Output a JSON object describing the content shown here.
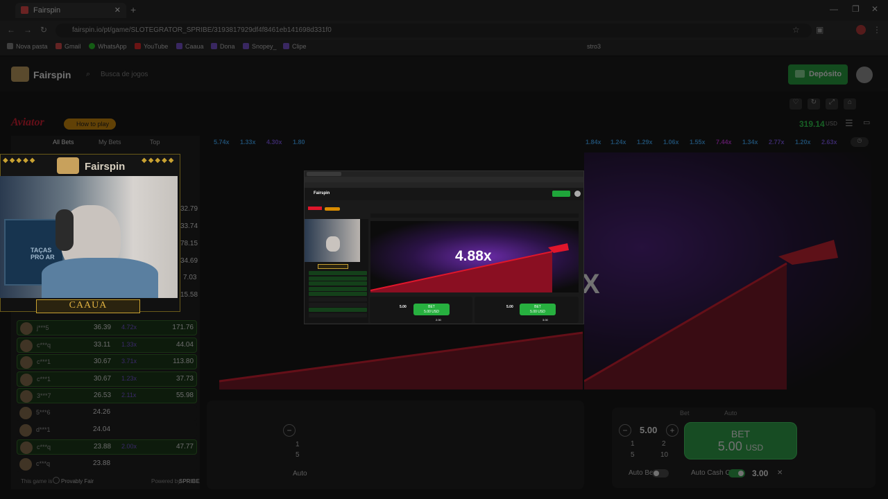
{
  "browser": {
    "tab_title": "Fairspin",
    "url": "fairspin.io/pt/game/SLOTEGRATOR_SPRIBE/3193817929df4f8461eb141698d331f0",
    "bookmarks": [
      "Nova pasta",
      "Gmail",
      "WhatsApp",
      "YouTube",
      "Caaua",
      "Dona",
      "Snopey_",
      "Clipe",
      "stro3"
    ]
  },
  "site": {
    "brand": "Fairspin",
    "search_placeholder": "Busca de jogos",
    "deposit_label": "Depósito",
    "balance": "319.14",
    "currency": "USD"
  },
  "game": {
    "title": "Aviator",
    "how_to_play": "How to play",
    "current_multiplier": "4.88x",
    "history": [
      "5.74x",
      "1.33x",
      "4.30x",
      "1.80"
    ],
    "history_right": [
      "1.84x",
      "1.24x",
      "1.29x",
      "1.06x",
      "1.55x",
      "7.44x",
      "1.34x",
      "2.77x",
      "1.20x",
      "2.63x"
    ]
  },
  "bets_panel": {
    "tabs": [
      "All Bets",
      "My Bets",
      "Top"
    ],
    "partial_values": [
      "32.79",
      "33.74",
      "78.15",
      "34.69",
      "7.03",
      "15.58"
    ],
    "rows": [
      {
        "user": "j***5",
        "bet": "36.39",
        "mult": "4.72x",
        "win": "171.76",
        "won": true
      },
      {
        "user": "c***q",
        "bet": "33.11",
        "mult": "1.33x",
        "win": "44.04",
        "won": true
      },
      {
        "user": "c***1",
        "bet": "30.67",
        "mult": "3.71x",
        "win": "113.80",
        "won": true
      },
      {
        "user": "c***1",
        "bet": "30.67",
        "mult": "1.23x",
        "win": "37.73",
        "won": true
      },
      {
        "user": "3***7",
        "bet": "26.53",
        "mult": "2.11x",
        "win": "55.98",
        "won": true
      },
      {
        "user": "5***6",
        "bet": "24.26",
        "mult": "",
        "win": "",
        "won": false
      },
      {
        "user": "d***1",
        "bet": "24.04",
        "mult": "",
        "win": "",
        "won": false
      },
      {
        "user": "c***q",
        "bet": "23.88",
        "mult": "2.00x",
        "win": "47.77",
        "won": true
      },
      {
        "user": "c***q",
        "bet": "23.88",
        "mult": "",
        "win": "",
        "won": false
      }
    ],
    "footer_fair": "This game is",
    "footer_fair_badge": "Provably Fair",
    "footer_powered": "Powered by",
    "footer_powered_brand": "SPRIBE"
  },
  "bet_control": {
    "mode_tabs": [
      "Bet",
      "Auto"
    ],
    "amount": "5.00",
    "quick": [
      "1",
      "2",
      "5",
      "10"
    ],
    "bet_label": "BET",
    "bet_amount": "5.00",
    "bet_currency": "USD",
    "auto_bet_label": "Auto Bet",
    "auto_cashout_label": "Auto Cash Out",
    "auto_cashout_value": "3.00",
    "left_quick": [
      "1",
      "5"
    ],
    "left_auto_label": "Auto"
  },
  "stream_overlay": {
    "brand": "Fairspin",
    "streamer": "CAAUA",
    "shirt_text": "TAÇAS PRO AR"
  },
  "mini": {
    "bet_amount": "5.00",
    "bet_label": "BET",
    "bet_sub": "5.00 USD",
    "cash": "2.00",
    "cash2": "3.00"
  }
}
